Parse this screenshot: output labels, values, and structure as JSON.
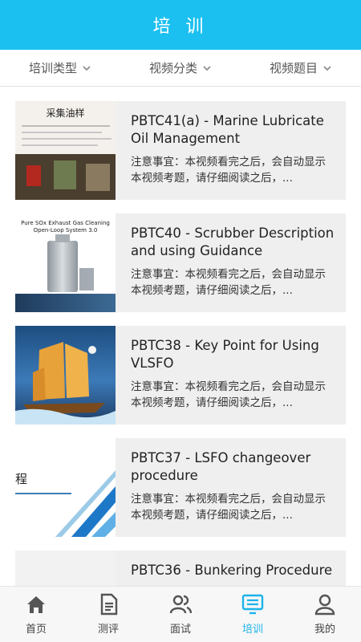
{
  "header": {
    "title": "培 训"
  },
  "filters": [
    {
      "label": "培训类型"
    },
    {
      "label": "视频分类"
    },
    {
      "label": "视频题目"
    }
  ],
  "videos": [
    {
      "title": "PBTC41(a) - Marine Lubricate Oil Management",
      "desc": "注意事宜：本视频看完之后，会自动显示本视频考题，请仔细阅读之后，...",
      "thumb_text": "采集油样",
      "thumb_icon": "oil-sampling-photo"
    },
    {
      "title": "PBTC40 - Scrubber Description and using Guidance",
      "desc": "注意事宜：本视频看完之后，会自动显示本视频考题，请仔细阅读之后，...",
      "thumb_text": "Pure SOx Exhaust Gas Cleaning Open-Loop System 3.0",
      "thumb_icon": "scrubber-image"
    },
    {
      "title": "PBTC38 - Key Point for Using VLSFO",
      "desc": "注意事宜：本视频看完之后，会自动显示本视频考题，请仔细阅读之后，...",
      "thumb_text": "",
      "thumb_icon": "sailing-ship-image"
    },
    {
      "title": "PBTC37 - LSFO changeover procedure",
      "desc": "注意事宜：本视频看完之后，会自动显示本视频考题，请仔细阅读之后，...",
      "thumb_text": "程",
      "thumb_icon": "slide-image"
    },
    {
      "title": "PBTC36 - Bunkering Procedure",
      "desc": "",
      "thumb_text": "",
      "thumb_icon": "blank-image"
    }
  ],
  "nav": [
    {
      "label": "首页",
      "icon": "home-icon"
    },
    {
      "label": "测评",
      "icon": "document-icon"
    },
    {
      "label": "面试",
      "icon": "users-icon"
    },
    {
      "label": "培训",
      "icon": "training-icon",
      "active": true
    },
    {
      "label": "我的",
      "icon": "user-icon"
    }
  ],
  "colors": {
    "primary": "#1bc0f0",
    "active_nav": "#1bb4ea"
  }
}
